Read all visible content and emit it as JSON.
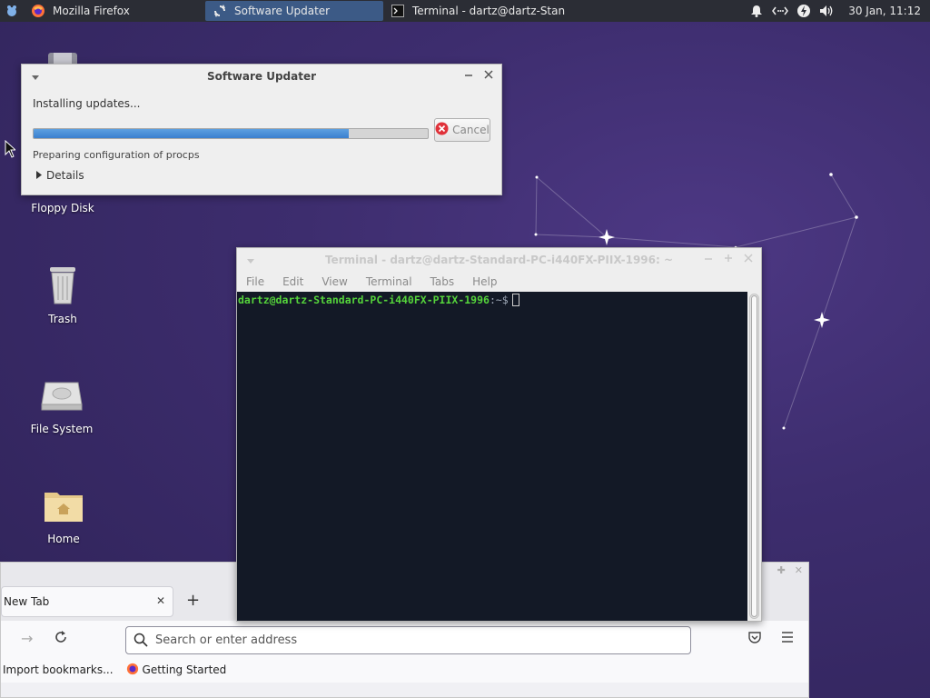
{
  "panel": {
    "tasks": [
      {
        "label": "Mozilla Firefox",
        "icon": "firefox-icon"
      },
      {
        "label": "Software Updater",
        "icon": "software-updater-icon",
        "active": true
      },
      {
        "label": "Terminal - dartz@dartz-Stan...",
        "icon": "terminal-icon"
      }
    ],
    "clock": "30 Jan, 11:12"
  },
  "desktop": {
    "icons": [
      {
        "label": "Floppy Disk"
      },
      {
        "label": "Trash"
      },
      {
        "label": "File System"
      },
      {
        "label": "Home"
      }
    ]
  },
  "updater": {
    "title": "Software Updater",
    "status": "Installing updates...",
    "progress": 0.8,
    "cancel_label": "Cancel",
    "substatus": "Preparing configuration of procps",
    "details_label": "Details"
  },
  "terminal": {
    "title": "Terminal - dartz@dartz-Standard-PC-i440FX-PIIX-1996: ~",
    "menu": [
      "File",
      "Edit",
      "View",
      "Terminal",
      "Tabs",
      "Help"
    ],
    "prompt_user": "dartz@dartz-Standard-PC-i440FX-PIIX-1996",
    "prompt_path": ":~$"
  },
  "firefox": {
    "tab_label": "New Tab",
    "url_placeholder": "Search or enter address",
    "bookmarks": [
      "Import bookmarks...",
      "Getting Started"
    ]
  },
  "colors": {
    "desktop_bg": "#3d2d6e",
    "panel_bg": "#2b2d35",
    "progress_fill": "#3a7fcf",
    "terminal_bg": "#131926",
    "prompt_green": "#55d43b"
  }
}
